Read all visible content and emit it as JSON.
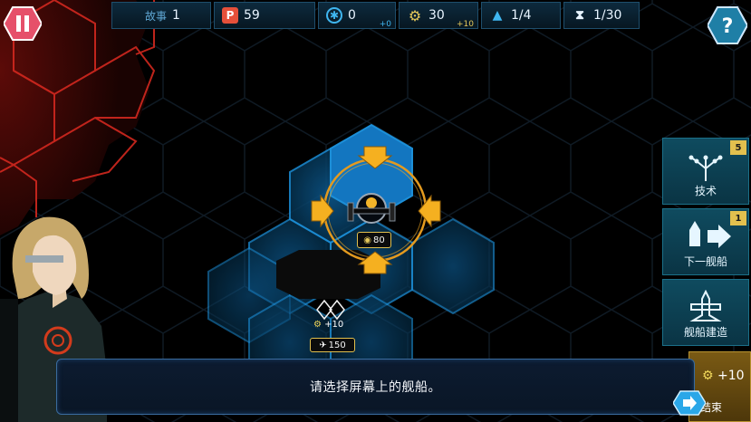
{
  "top_bar": {
    "story": {
      "label": "故事",
      "value": "1"
    },
    "p": {
      "icon": "p-badge-icon",
      "value": "59"
    },
    "blue": {
      "icon": "blue-gear-icon",
      "value": "0",
      "delta": "+0"
    },
    "gold": {
      "icon": "gold-gear-icon",
      "value": "30",
      "delta": "+10"
    },
    "ships": {
      "icon": "ship-icon",
      "value": "1/4"
    },
    "turns": {
      "icon": "hourglass-icon",
      "value": "1/30"
    }
  },
  "side_panel": {
    "tech": {
      "label": "技术",
      "badge": "5"
    },
    "next_ship": {
      "label": "下一舰船",
      "badge": "1"
    },
    "build": {
      "label": "舰船建造"
    },
    "end_turn": {
      "label": "结束",
      "bonus": "+10"
    }
  },
  "map": {
    "selected_ship_label": "80",
    "build_gear_bonus": "+10",
    "build_cost": "150"
  },
  "dialog": {
    "text": "请选择屏幕上的舰船。"
  },
  "colors": {
    "accent_gold": "#f1a822",
    "hex_blue": "#0c5f9a",
    "enemy_red": "#c7221c",
    "panel_teal": "#0f4b5f"
  }
}
